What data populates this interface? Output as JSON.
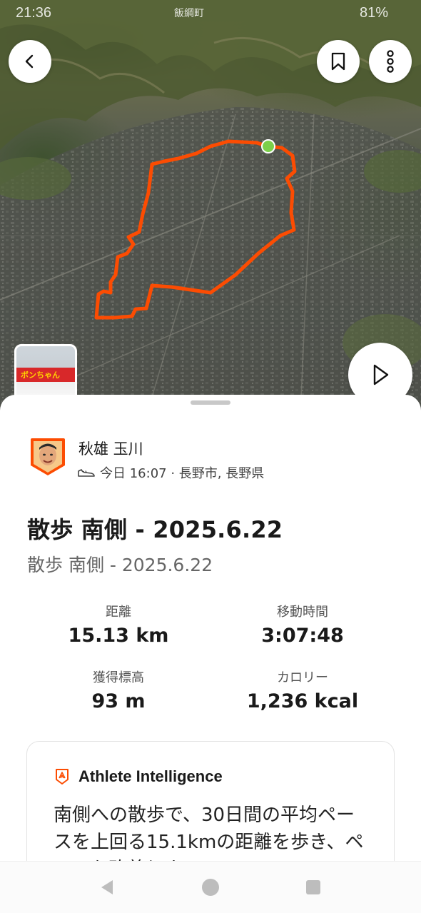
{
  "status_bar": {
    "time": "21:36",
    "carrier": "飯綱町",
    "battery": "81%"
  },
  "map": {
    "back_icon": "chevron-left-icon",
    "bookmark_icon": "bookmark-icon",
    "more_icon": "more-vertical-icon",
    "play_icon": "play-icon",
    "route_color": "#fc4c02",
    "start_marker_color": "#7bd04a",
    "photo_sign_text": "ボンちゃん"
  },
  "activity": {
    "athlete_name": "秋雄 玉川",
    "activity_icon": "walking-shoe-icon",
    "meta": "今日 16:07 · 長野市, 長野県",
    "title": "散歩 南側 - 2025.6.22",
    "description": "散歩 南側 - 2025.6.22",
    "stats": [
      {
        "label": "距離",
        "value": "15.13 km"
      },
      {
        "label": "移動時間",
        "value": "3:07:48"
      },
      {
        "label": "獲得標高",
        "value": "93 m"
      },
      {
        "label": "カロリー",
        "value": "1,236 kcal"
      }
    ]
  },
  "athlete_intelligence": {
    "icon": "athlete-intelligence-icon",
    "title": "Athlete Intelligence",
    "text": "南側への散歩で、30日間の平均ペースを上回る15.1kmの距離を歩き、ペースを改善しま"
  },
  "nav": {
    "back_icon": "nav-back-icon",
    "home_icon": "nav-home-icon",
    "recents_icon": "nav-recents-icon"
  },
  "colors": {
    "brand": "#fc4c02",
    "text": "#1a1a1a",
    "muted": "#666666"
  }
}
